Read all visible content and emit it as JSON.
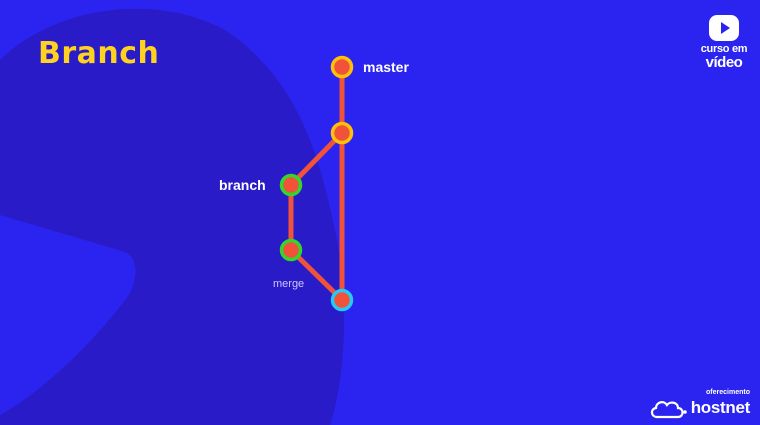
{
  "slide": {
    "title": "Branch",
    "colors": {
      "background": "#2b24f0",
      "shape": "#2a1bc9",
      "title": "#ffd21f",
      "edge": "#f0533a"
    }
  },
  "diagram": {
    "labels": {
      "master": "master",
      "branch": "branch",
      "merge": "merge"
    },
    "nodes": [
      {
        "id": "m1",
        "ring": "#ffc107"
      },
      {
        "id": "m2",
        "ring": "#ffc107"
      },
      {
        "id": "b1",
        "ring": "#35d62c"
      },
      {
        "id": "b2",
        "ring": "#35d62c"
      },
      {
        "id": "merge",
        "ring": "#27c9f5"
      }
    ],
    "edges": [
      [
        "m1",
        "m2"
      ],
      [
        "m2",
        "b1"
      ],
      [
        "b1",
        "b2"
      ],
      [
        "b2",
        "merge"
      ],
      [
        "m2",
        "merge"
      ]
    ]
  },
  "branding": {
    "logo_line1": "curso em",
    "logo_line2": "vídeo",
    "sponsor_label": "oferecimento",
    "sponsor_name": "hostnet",
    "icons": [
      "play-icon",
      "cloud-icon"
    ]
  }
}
